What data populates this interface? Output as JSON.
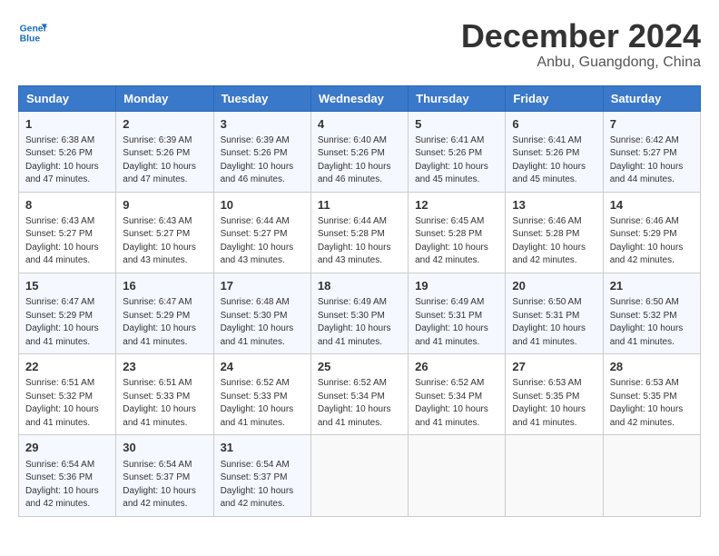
{
  "header": {
    "logo_line1": "General",
    "logo_line2": "Blue",
    "main_title": "December 2024",
    "subtitle": "Anbu, Guangdong, China"
  },
  "weekdays": [
    "Sunday",
    "Monday",
    "Tuesday",
    "Wednesday",
    "Thursday",
    "Friday",
    "Saturday"
  ],
  "weeks": [
    [
      {
        "day": "1",
        "sunrise": "Sunrise: 6:38 AM",
        "sunset": "Sunset: 5:26 PM",
        "daylight": "Daylight: 10 hours and 47 minutes."
      },
      {
        "day": "2",
        "sunrise": "Sunrise: 6:39 AM",
        "sunset": "Sunset: 5:26 PM",
        "daylight": "Daylight: 10 hours and 47 minutes."
      },
      {
        "day": "3",
        "sunrise": "Sunrise: 6:39 AM",
        "sunset": "Sunset: 5:26 PM",
        "daylight": "Daylight: 10 hours and 46 minutes."
      },
      {
        "day": "4",
        "sunrise": "Sunrise: 6:40 AM",
        "sunset": "Sunset: 5:26 PM",
        "daylight": "Daylight: 10 hours and 46 minutes."
      },
      {
        "day": "5",
        "sunrise": "Sunrise: 6:41 AM",
        "sunset": "Sunset: 5:26 PM",
        "daylight": "Daylight: 10 hours and 45 minutes."
      },
      {
        "day": "6",
        "sunrise": "Sunrise: 6:41 AM",
        "sunset": "Sunset: 5:26 PM",
        "daylight": "Daylight: 10 hours and 45 minutes."
      },
      {
        "day": "7",
        "sunrise": "Sunrise: 6:42 AM",
        "sunset": "Sunset: 5:27 PM",
        "daylight": "Daylight: 10 hours and 44 minutes."
      }
    ],
    [
      {
        "day": "8",
        "sunrise": "Sunrise: 6:43 AM",
        "sunset": "Sunset: 5:27 PM",
        "daylight": "Daylight: 10 hours and 44 minutes."
      },
      {
        "day": "9",
        "sunrise": "Sunrise: 6:43 AM",
        "sunset": "Sunset: 5:27 PM",
        "daylight": "Daylight: 10 hours and 43 minutes."
      },
      {
        "day": "10",
        "sunrise": "Sunrise: 6:44 AM",
        "sunset": "Sunset: 5:27 PM",
        "daylight": "Daylight: 10 hours and 43 minutes."
      },
      {
        "day": "11",
        "sunrise": "Sunrise: 6:44 AM",
        "sunset": "Sunset: 5:28 PM",
        "daylight": "Daylight: 10 hours and 43 minutes."
      },
      {
        "day": "12",
        "sunrise": "Sunrise: 6:45 AM",
        "sunset": "Sunset: 5:28 PM",
        "daylight": "Daylight: 10 hours and 42 minutes."
      },
      {
        "day": "13",
        "sunrise": "Sunrise: 6:46 AM",
        "sunset": "Sunset: 5:28 PM",
        "daylight": "Daylight: 10 hours and 42 minutes."
      },
      {
        "day": "14",
        "sunrise": "Sunrise: 6:46 AM",
        "sunset": "Sunset: 5:29 PM",
        "daylight": "Daylight: 10 hours and 42 minutes."
      }
    ],
    [
      {
        "day": "15",
        "sunrise": "Sunrise: 6:47 AM",
        "sunset": "Sunset: 5:29 PM",
        "daylight": "Daylight: 10 hours and 41 minutes."
      },
      {
        "day": "16",
        "sunrise": "Sunrise: 6:47 AM",
        "sunset": "Sunset: 5:29 PM",
        "daylight": "Daylight: 10 hours and 41 minutes."
      },
      {
        "day": "17",
        "sunrise": "Sunrise: 6:48 AM",
        "sunset": "Sunset: 5:30 PM",
        "daylight": "Daylight: 10 hours and 41 minutes."
      },
      {
        "day": "18",
        "sunrise": "Sunrise: 6:49 AM",
        "sunset": "Sunset: 5:30 PM",
        "daylight": "Daylight: 10 hours and 41 minutes."
      },
      {
        "day": "19",
        "sunrise": "Sunrise: 6:49 AM",
        "sunset": "Sunset: 5:31 PM",
        "daylight": "Daylight: 10 hours and 41 minutes."
      },
      {
        "day": "20",
        "sunrise": "Sunrise: 6:50 AM",
        "sunset": "Sunset: 5:31 PM",
        "daylight": "Daylight: 10 hours and 41 minutes."
      },
      {
        "day": "21",
        "sunrise": "Sunrise: 6:50 AM",
        "sunset": "Sunset: 5:32 PM",
        "daylight": "Daylight: 10 hours and 41 minutes."
      }
    ],
    [
      {
        "day": "22",
        "sunrise": "Sunrise: 6:51 AM",
        "sunset": "Sunset: 5:32 PM",
        "daylight": "Daylight: 10 hours and 41 minutes."
      },
      {
        "day": "23",
        "sunrise": "Sunrise: 6:51 AM",
        "sunset": "Sunset: 5:33 PM",
        "daylight": "Daylight: 10 hours and 41 minutes."
      },
      {
        "day": "24",
        "sunrise": "Sunrise: 6:52 AM",
        "sunset": "Sunset: 5:33 PM",
        "daylight": "Daylight: 10 hours and 41 minutes."
      },
      {
        "day": "25",
        "sunrise": "Sunrise: 6:52 AM",
        "sunset": "Sunset: 5:34 PM",
        "daylight": "Daylight: 10 hours and 41 minutes."
      },
      {
        "day": "26",
        "sunrise": "Sunrise: 6:52 AM",
        "sunset": "Sunset: 5:34 PM",
        "daylight": "Daylight: 10 hours and 41 minutes."
      },
      {
        "day": "27",
        "sunrise": "Sunrise: 6:53 AM",
        "sunset": "Sunset: 5:35 PM",
        "daylight": "Daylight: 10 hours and 41 minutes."
      },
      {
        "day": "28",
        "sunrise": "Sunrise: 6:53 AM",
        "sunset": "Sunset: 5:35 PM",
        "daylight": "Daylight: 10 hours and 42 minutes."
      }
    ],
    [
      {
        "day": "29",
        "sunrise": "Sunrise: 6:54 AM",
        "sunset": "Sunset: 5:36 PM",
        "daylight": "Daylight: 10 hours and 42 minutes."
      },
      {
        "day": "30",
        "sunrise": "Sunrise: 6:54 AM",
        "sunset": "Sunset: 5:37 PM",
        "daylight": "Daylight: 10 hours and 42 minutes."
      },
      {
        "day": "31",
        "sunrise": "Sunrise: 6:54 AM",
        "sunset": "Sunset: 5:37 PM",
        "daylight": "Daylight: 10 hours and 42 minutes."
      },
      null,
      null,
      null,
      null
    ]
  ]
}
